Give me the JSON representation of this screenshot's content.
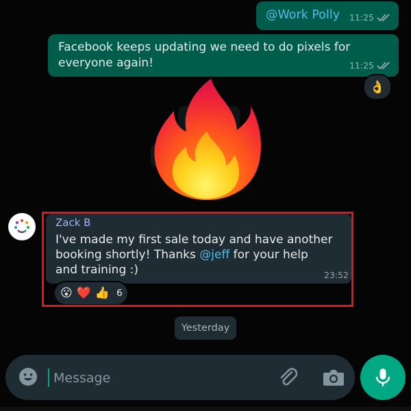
{
  "chat": {
    "messages": {
      "mention": {
        "text": "@Work Polly",
        "time": "11:25"
      },
      "outgoing_text": {
        "text": "Facebook keeps updating we need to do pixels for everyone again!",
        "time": "11:25",
        "reaction": "👌"
      },
      "sticker": {
        "icon": "fire-sticker-icon"
      },
      "incoming": {
        "sender": "Zack B",
        "text_before_mention": "I've made my first sale today and have another booking shortly! Thanks ",
        "mention": "@jeff",
        "text_after_mention": " for your help and training :)",
        "time": "23:52",
        "reactions": [
          "😮",
          "❤️",
          "👍"
        ],
        "reaction_count": "6"
      }
    },
    "date_divider": "Yesterday"
  },
  "composer": {
    "placeholder": "Message",
    "emoji_icon": "emoji-icon",
    "attach_icon": "paperclip-icon",
    "camera_icon": "camera-icon",
    "mic_icon": "microphone-icon"
  },
  "colors": {
    "outgoing_bubble": "#005c4b",
    "incoming_bubble": "#1f2c33",
    "mention": "#53bdeb",
    "sender_name": "#a5b6f4",
    "highlight_border": "#e4141c",
    "accent": "#00a884"
  }
}
